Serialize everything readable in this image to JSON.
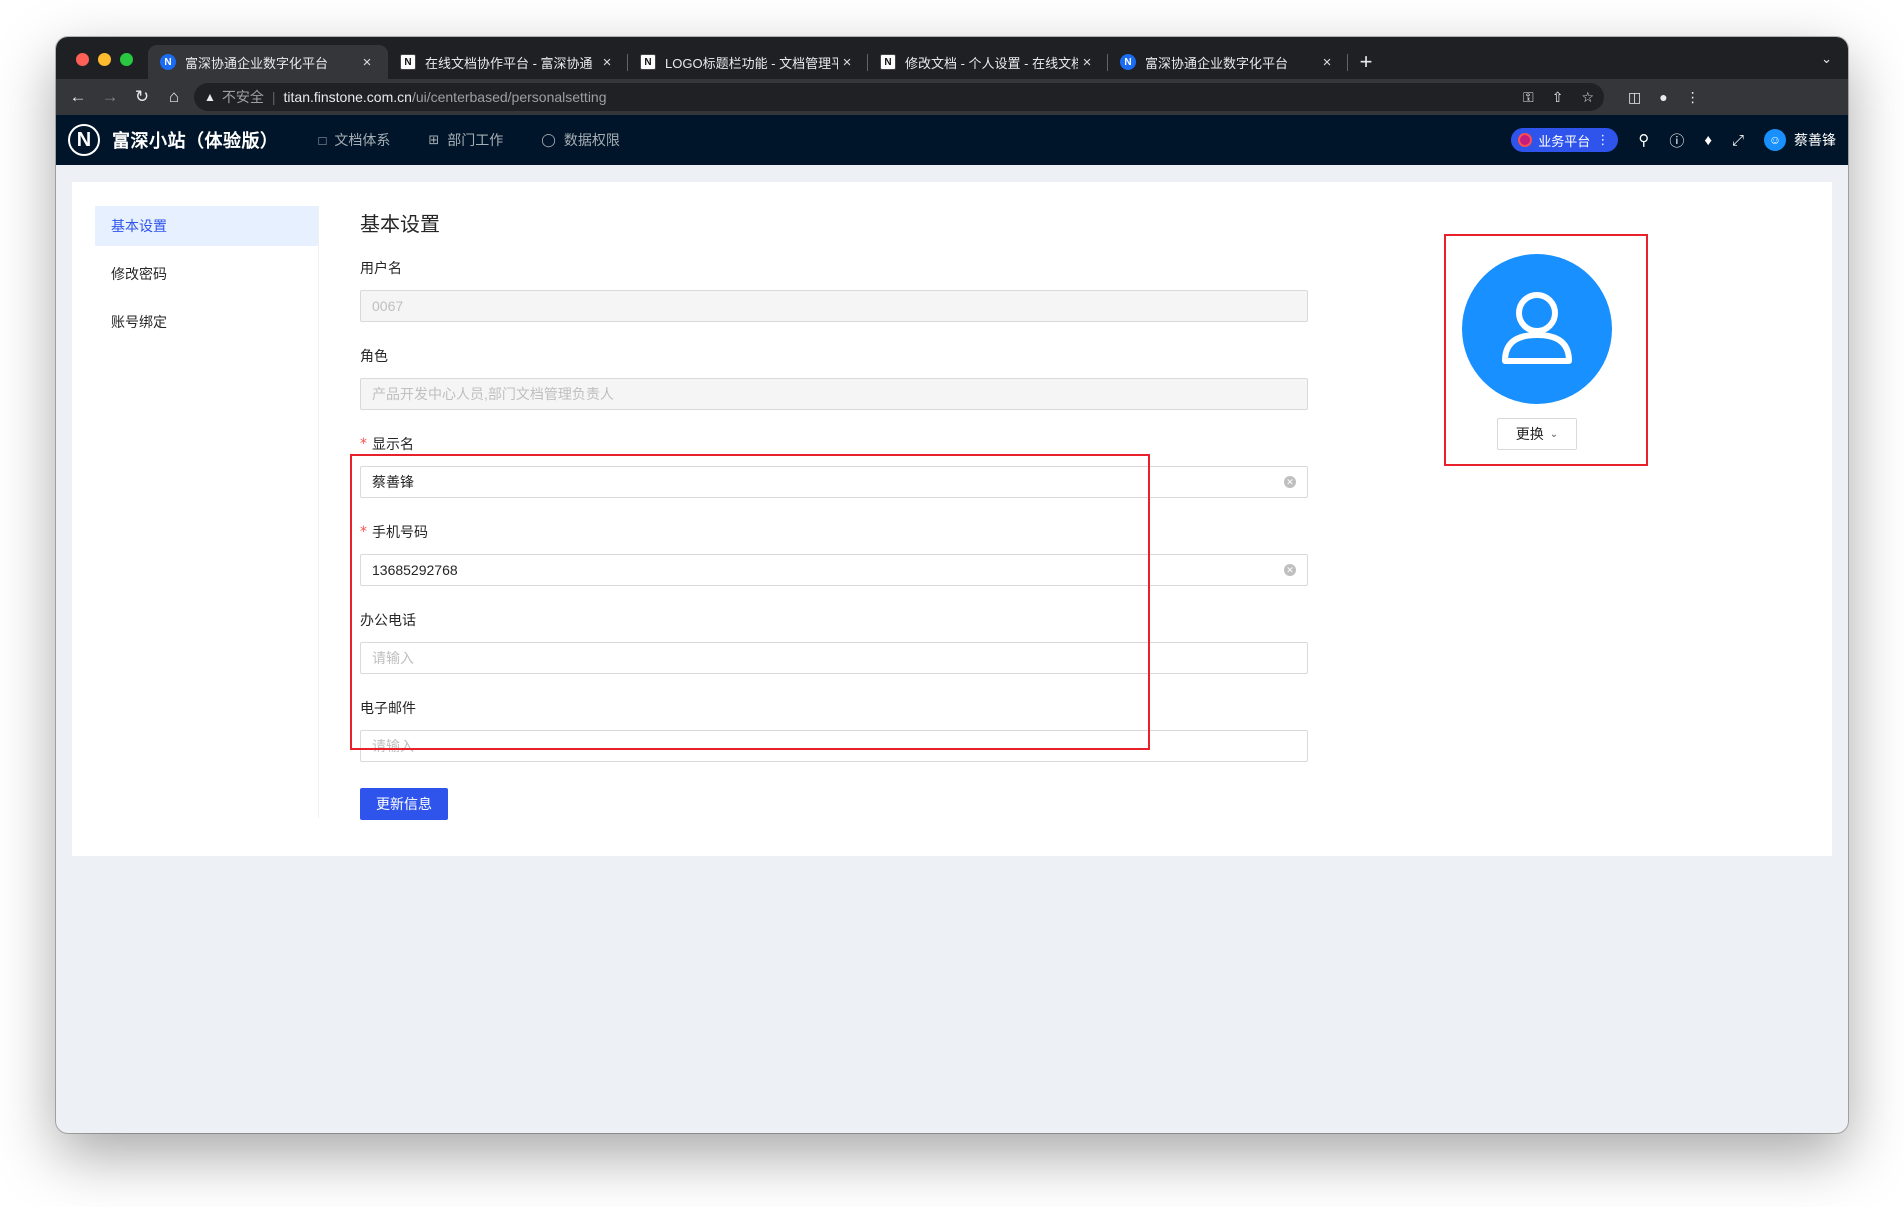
{
  "browser": {
    "tabs": [
      {
        "favicon": "N",
        "title": "富深协通企业数字化平台",
        "active": true
      },
      {
        "favicon": "doc",
        "title": "在线文档协作平台 - 富深协通",
        "active": false
      },
      {
        "favicon": "doc",
        "title": "LOGO标题栏功能 - 文档管理平台",
        "active": false
      },
      {
        "favicon": "doc",
        "title": "修改文档 - 个人设置 - 在线文档协",
        "active": false
      },
      {
        "favicon": "N",
        "title": "富深协通企业数字化平台",
        "active": false
      }
    ],
    "close_glyph": "×",
    "new_tab_glyph": "+",
    "security_label": "不安全",
    "url_host": "titan.finstone.com.cn",
    "url_path": "/ui/centerbased/personalsetting"
  },
  "app": {
    "logo_letter": "N",
    "title": "富深小站（体验版）",
    "menu": [
      {
        "label": "文档体系",
        "icon": "file-icon"
      },
      {
        "label": "部门工作",
        "icon": "grid-icon"
      },
      {
        "label": "数据权限",
        "icon": "shield-icon"
      }
    ],
    "platform_label": "业务平台",
    "user_name": "蔡善锋"
  },
  "sidebar": {
    "items": [
      {
        "label": "基本设置",
        "active": true
      },
      {
        "label": "修改密码",
        "active": false
      },
      {
        "label": "账号绑定",
        "active": false
      }
    ]
  },
  "form": {
    "title": "基本设置",
    "username": {
      "label": "用户名",
      "value": "0067"
    },
    "role": {
      "label": "角色",
      "value": "产品开发中心人员,部门文档管理负责人"
    },
    "display_name": {
      "label": "显示名",
      "value": "蔡善锋",
      "required": true
    },
    "mobile": {
      "label": "手机号码",
      "value": "13685292768",
      "required": true
    },
    "office_phone": {
      "label": "办公电话",
      "placeholder": "请输入"
    },
    "email": {
      "label": "电子邮件",
      "placeholder": "请输入"
    },
    "required_mark": "*",
    "submit_label": "更新信息"
  },
  "avatar": {
    "change_label": "更换"
  },
  "colors": {
    "header_bg": "#001529",
    "primary": "#2f54eb",
    "avatar_blue": "#1890ff",
    "highlight_red": "#e8212b"
  }
}
